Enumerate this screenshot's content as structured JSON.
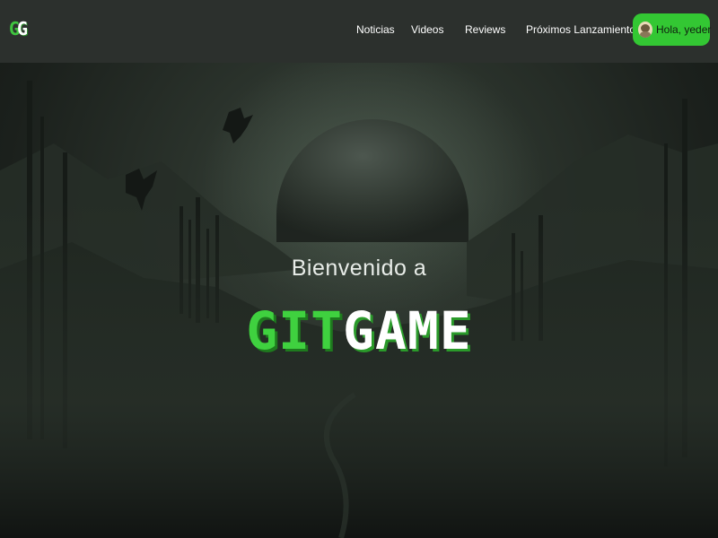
{
  "navbar": {
    "logo": {
      "part1": "G",
      "part2": "G"
    },
    "links": [
      {
        "label": "Noticias"
      },
      {
        "label": "Videos"
      },
      {
        "label": "Reviews"
      },
      {
        "label": "Próximos Lanzamientos"
      }
    ],
    "user": {
      "greeting": "Hola, yeder",
      "avatar": "user-avatar"
    }
  },
  "hero": {
    "subtitle": "Bienvenido a",
    "title": {
      "part1": "GIT",
      "part2": "GAME"
    }
  },
  "colors": {
    "accent": "#33c733",
    "navbar_bg": "#2c302d",
    "hero_bg": "#1b201c"
  }
}
